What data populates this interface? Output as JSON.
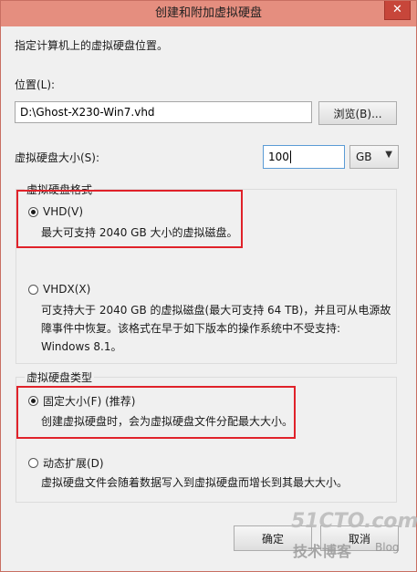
{
  "window": {
    "title": "创建和附加虚拟硬盘",
    "close_glyph": "✕"
  },
  "intro": "指定计算机上的虚拟硬盘位置。",
  "location": {
    "label": "位置(L):",
    "value": "D:\\Ghost-X230-Win7.vhd",
    "browse_label": "浏览(B)..."
  },
  "size": {
    "label": "虚拟硬盘大小(S):",
    "value": "100",
    "unit": "GB"
  },
  "format_group": {
    "legend": "虚拟硬盘格式",
    "options": [
      {
        "label": "VHD(V)",
        "checked": true,
        "desc": [
          "最大可支持 2040 GB 大小的虚拟磁盘。"
        ]
      },
      {
        "label": "VHDX(X)",
        "checked": false,
        "desc": [
          "可支持大于 2040 GB 的虚拟磁盘(最大可支持 64 TB)，并且可从电源故",
          "障事件中恢复。该格式在早于如下版本的操作系统中不受支持:",
          "Windows 8.1。"
        ]
      }
    ]
  },
  "type_group": {
    "legend": "虚拟硬盘类型",
    "options": [
      {
        "label": "固定大小(F) (推荐)",
        "checked": true,
        "desc": [
          "创建虚拟硬盘时，会为虚拟硬盘文件分配最大大小。"
        ]
      },
      {
        "label": "动态扩展(D)",
        "checked": false,
        "desc": [
          "虚拟硬盘文件会随着数据写入到虚拟硬盘而增长到其最大大小。"
        ]
      }
    ]
  },
  "buttons": {
    "ok": "确定",
    "cancel": "取消"
  },
  "watermark": {
    "site": "51CTO.com",
    "sub": "技术博客",
    "blog": "Blog"
  },
  "colors": {
    "titlebar": "#e58e7f",
    "highlight": "#e0222a"
  }
}
